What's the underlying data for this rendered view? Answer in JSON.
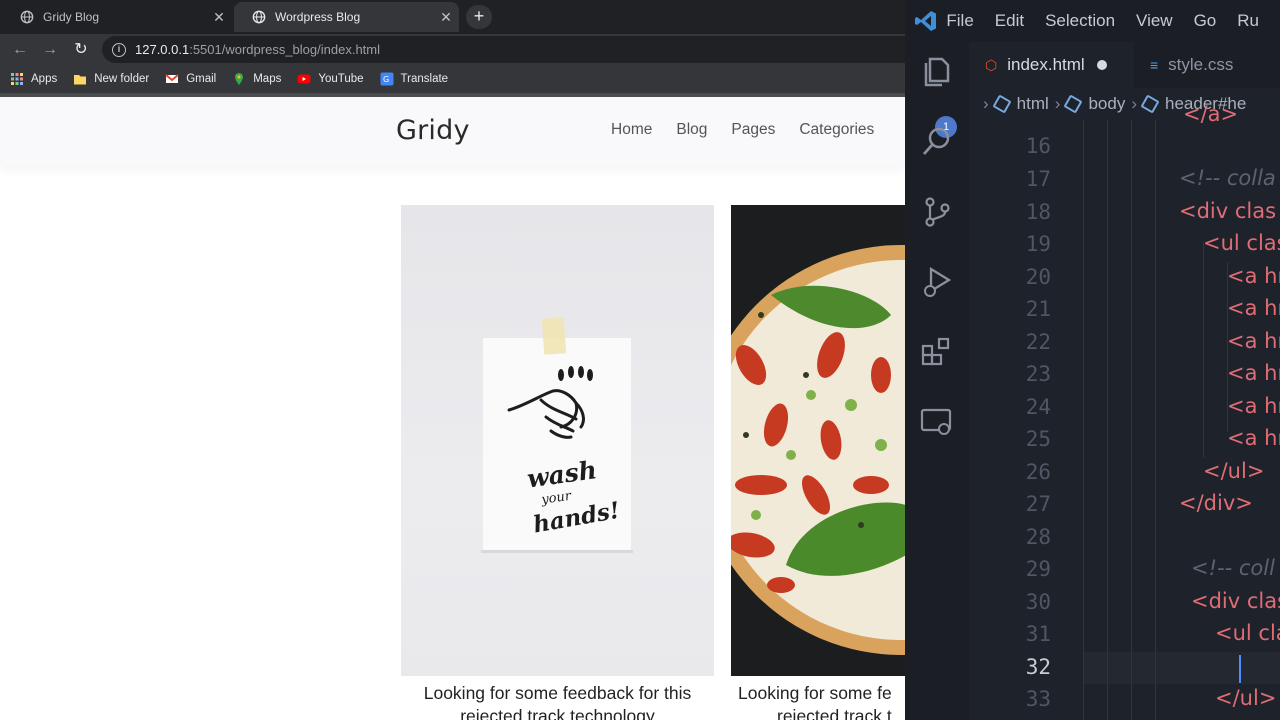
{
  "browser": {
    "tabs": [
      {
        "title": "Gridy Blog",
        "active": false
      },
      {
        "title": "Wordpress Blog",
        "active": true
      }
    ],
    "new_tab": "+",
    "url_host": "127.0.0.1",
    "url_rest": ":5501/wordpress_blog/index.html",
    "bookmarks": [
      {
        "label": "Apps",
        "icon": "apps-grid-icon"
      },
      {
        "label": "New folder",
        "icon": "folder-icon"
      },
      {
        "label": "Gmail",
        "icon": "gmail-icon"
      },
      {
        "label": "Maps",
        "icon": "maps-icon"
      },
      {
        "label": "YouTube",
        "icon": "youtube-icon"
      },
      {
        "label": "Translate",
        "icon": "translate-icon"
      }
    ]
  },
  "site": {
    "logo": "Gridy",
    "nav": [
      "Home",
      "Blog",
      "Pages",
      "Categories"
    ],
    "cards": [
      {
        "title_line1": "Looking for some feedback for this",
        "title_line2": "rejected track technology",
        "image": "wash-your-hands-note-photo"
      },
      {
        "title_line1": "Looking for some fe",
        "title_line2": "rejected track t",
        "image": "pizza-photo"
      }
    ],
    "note_text": [
      "wash",
      "your",
      "hands!"
    ]
  },
  "vscode": {
    "menu": [
      "File",
      "Edit",
      "Selection",
      "View",
      "Go",
      "Ru"
    ],
    "badge": "1",
    "tabs": [
      {
        "label": "index.html",
        "icon": "html5-icon",
        "modified": true
      },
      {
        "label": "style.css",
        "icon": "css3-icon",
        "modified": false
      }
    ],
    "breadcrumb": [
      "html",
      "body",
      "header#he"
    ],
    "lines": [
      {
        "n": "",
        "code": "</a>"
      },
      {
        "n": "16",
        "code": ""
      },
      {
        "n": "17",
        "code": "<!-- colla"
      },
      {
        "n": "18",
        "code": "<div clas"
      },
      {
        "n": "19",
        "code": "<ul clas"
      },
      {
        "n": "20",
        "code": "<a hr"
      },
      {
        "n": "21",
        "code": "<a hr"
      },
      {
        "n": "22",
        "code": "<a hr"
      },
      {
        "n": "23",
        "code": "<a hr"
      },
      {
        "n": "24",
        "code": "<a hr"
      },
      {
        "n": "25",
        "code": "<a hr"
      },
      {
        "n": "26",
        "code": "</ul>"
      },
      {
        "n": "27",
        "code": "</div>"
      },
      {
        "n": "28",
        "code": ""
      },
      {
        "n": "29",
        "code": "<!-- coll"
      },
      {
        "n": "30",
        "code": "<div clas"
      },
      {
        "n": "31",
        "code": "<ul cla"
      },
      {
        "n": "32",
        "code": ""
      },
      {
        "n": "33",
        "code": "</ul>"
      }
    ],
    "colors": {
      "keyword_tag": "#e06c75",
      "comment": "#5c6370",
      "accent": "#528bff"
    }
  }
}
